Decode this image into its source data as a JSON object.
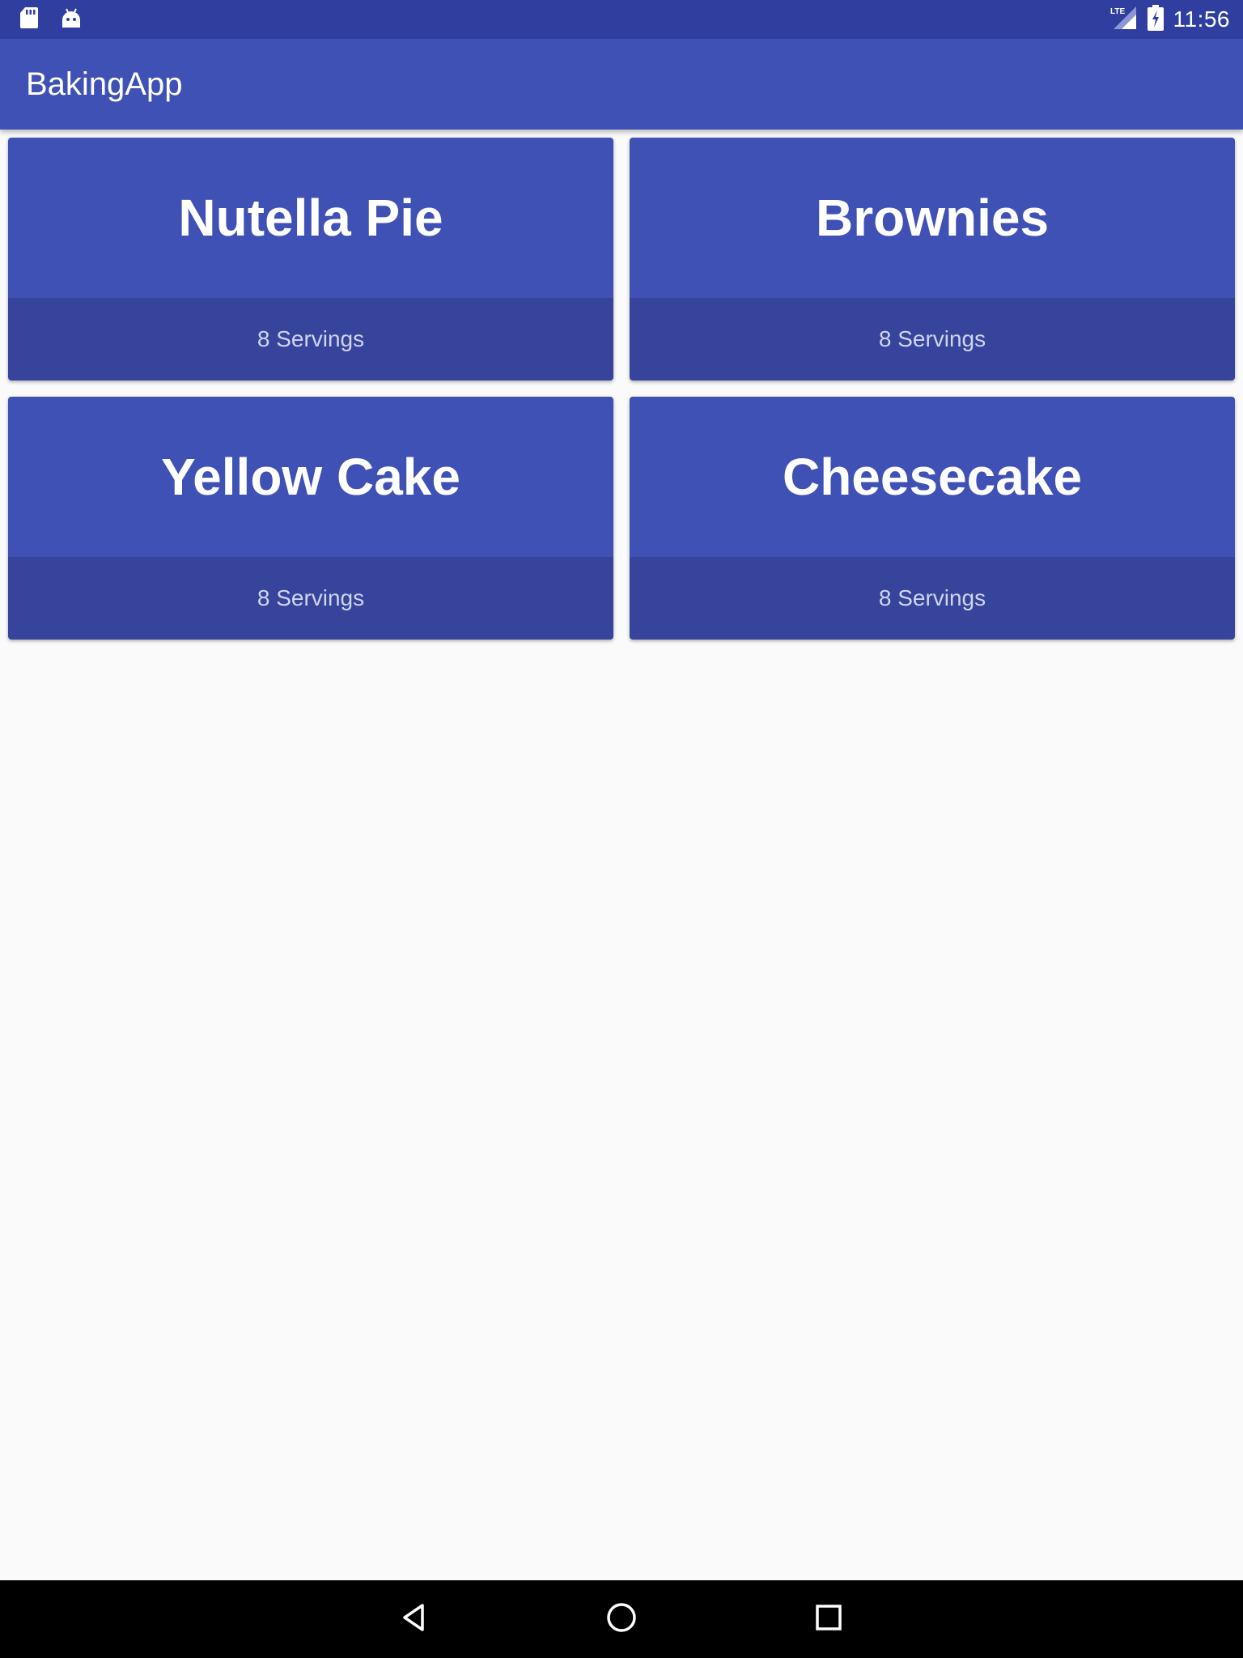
{
  "status_bar": {
    "time": "11:56",
    "network_label": "LTE",
    "icons": [
      "sd-card-icon",
      "android-debug-icon",
      "lte-signal-icon",
      "battery-charging-icon"
    ]
  },
  "app_bar": {
    "title": "BakingApp"
  },
  "recipes": [
    {
      "name": "Nutella Pie",
      "servings": "8 Servings"
    },
    {
      "name": "Brownies",
      "servings": "8 Servings"
    },
    {
      "name": "Yellow Cake",
      "servings": "8 Servings"
    },
    {
      "name": "Cheesecake",
      "servings": "8 Servings"
    }
  ],
  "nav_bar": {
    "icons": [
      "back-icon",
      "home-icon",
      "recents-icon"
    ]
  },
  "colors": {
    "status_bar": "#303f9f",
    "primary": "#3f51b5",
    "card_footer": "#36449b",
    "background": "#fafafa",
    "nav_bar": "#000000"
  }
}
